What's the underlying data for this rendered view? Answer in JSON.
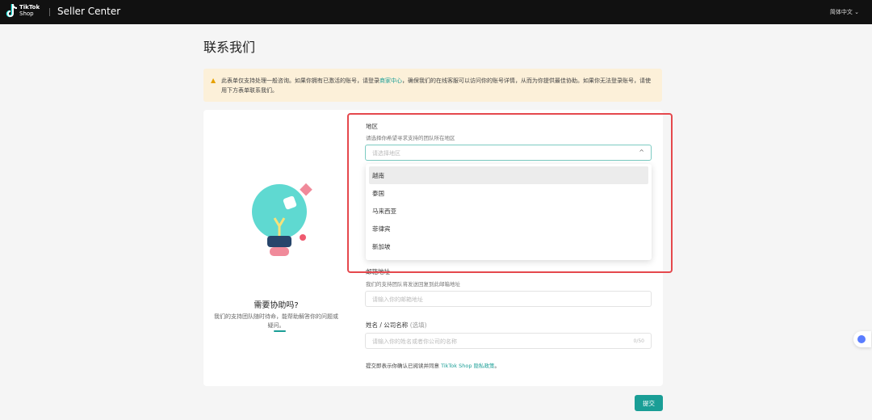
{
  "header": {
    "logo_line1": "TikTok",
    "logo_line2": "Shop",
    "brand": "Seller Center",
    "language": "简体中文"
  },
  "page_title": "联系我们",
  "notice": {
    "text_before": "此表单仅支持处理一般咨询。如果你拥有已激活的账号，请登录",
    "link": "商家中心",
    "text_after": "，确保我们的在线客服可以访问你的账号详情，从而为你提供最佳协助。如果你无法登录账号，请使用下方表单联系我们。"
  },
  "help": {
    "title": "需要协助吗?",
    "desc": "我们的支持团队随时待命，能帮助解答你的问题或疑问。"
  },
  "region": {
    "label": "地区",
    "hint": "请选择你希望寻求支持的团队所在地区",
    "placeholder": "请选择地区",
    "options": [
      "越南",
      "泰国",
      "马来西亚",
      "菲律宾",
      "新加坡"
    ]
  },
  "email": {
    "label": "邮箱地址",
    "hint": "我们的支持团队将发送回复到此邮箱地址",
    "placeholder": "请输入你的邮箱地址"
  },
  "name": {
    "label": "姓名 / 公司名称",
    "optional": "(选填)",
    "placeholder": "请输入你的姓名或者你公司的名称",
    "count": "0/50"
  },
  "privacy": {
    "text": "提交即表示你确认已阅读并同意 ",
    "link": "TikTok Shop 隐私政策",
    "end": "。"
  },
  "submit_label": "提交",
  "colors": {
    "accent": "#1a9e96",
    "highlight": "#e5484d"
  }
}
